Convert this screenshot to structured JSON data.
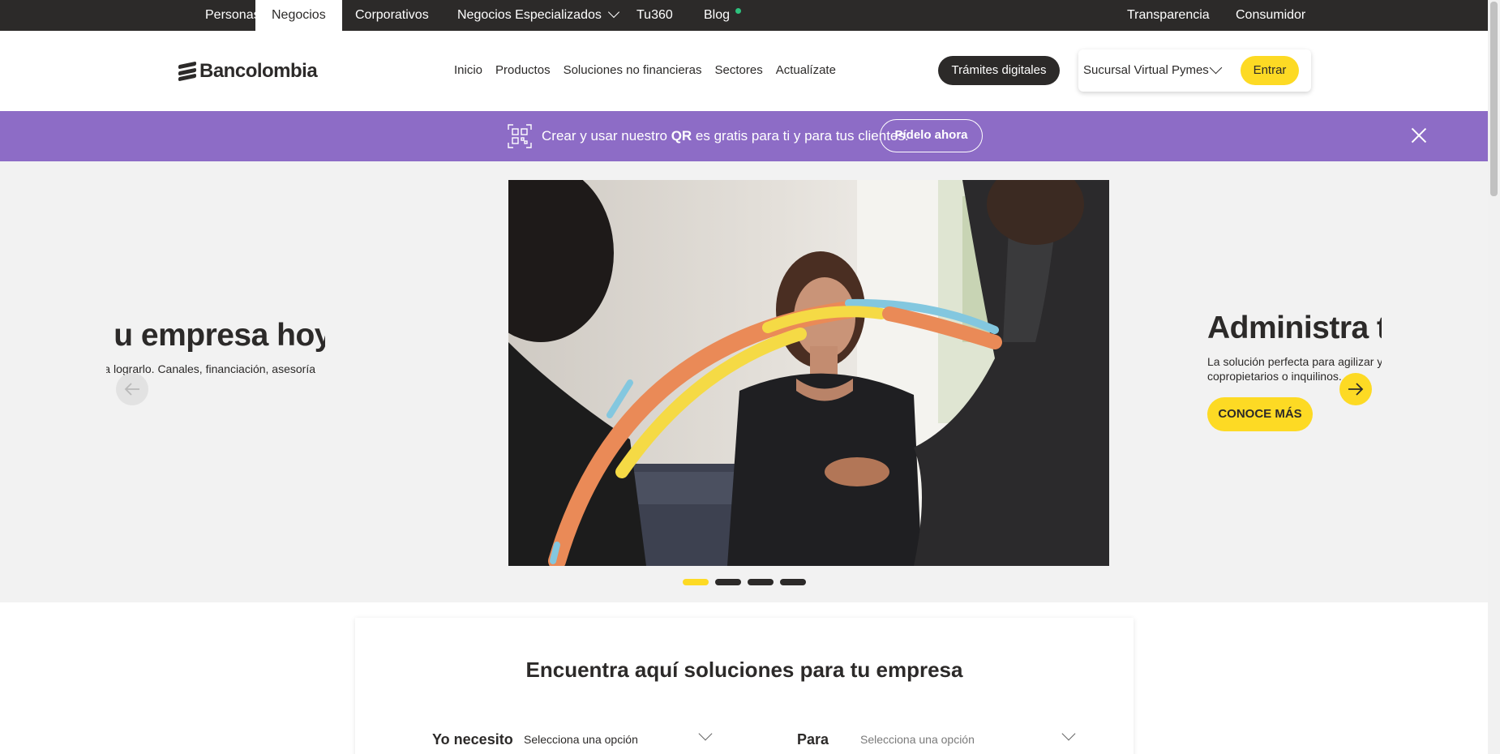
{
  "topbar": {
    "items": [
      "Personas",
      "Negocios",
      "Corporativos",
      "Negocios Especializados",
      "Tu360",
      "Blog"
    ],
    "right_items": [
      "Transparencia",
      "Consumidor"
    ],
    "active": "Negocios"
  },
  "header": {
    "logo_text": "Bancolombia",
    "nav": [
      "Inicio",
      "Productos",
      "Soluciones no financieras",
      "Sectores",
      "Actualízate"
    ],
    "tramites_label": "Trámites digitales",
    "sucursal_label": "Sucursal Virtual Pymes",
    "entrar_label": "Entrar"
  },
  "promo": {
    "text_before": "Crear y usar nuestro ",
    "text_bold": "QR",
    "text_after": " es gratis para ti y para tus clientes.",
    "button_label": "Pídelo ahora"
  },
  "carousel": {
    "prev_slide": {
      "title": "u empresa hoy",
      "subtitle": "a lograrlo. Canales, financiación, asesoría"
    },
    "next_slide": {
      "title": "Administra t",
      "subtitle": "La solución perfecta para agilizar y copropietarios o inquilinos.",
      "button_label": "CONOCE MÁS"
    },
    "slide_count": 4,
    "active_index": 0
  },
  "finder": {
    "title": "Encuentra aquí soluciones para tu empresa",
    "need_label": "Yo necesito",
    "need_value": "Selecciona una opción",
    "for_label": "Para",
    "for_placeholder": "Selecciona una opción"
  },
  "colors": {
    "dark": "#2c2a29",
    "yellow": "#fdda24",
    "purple": "#8d6cc6",
    "carousel_bg": "#f2f2f2"
  }
}
